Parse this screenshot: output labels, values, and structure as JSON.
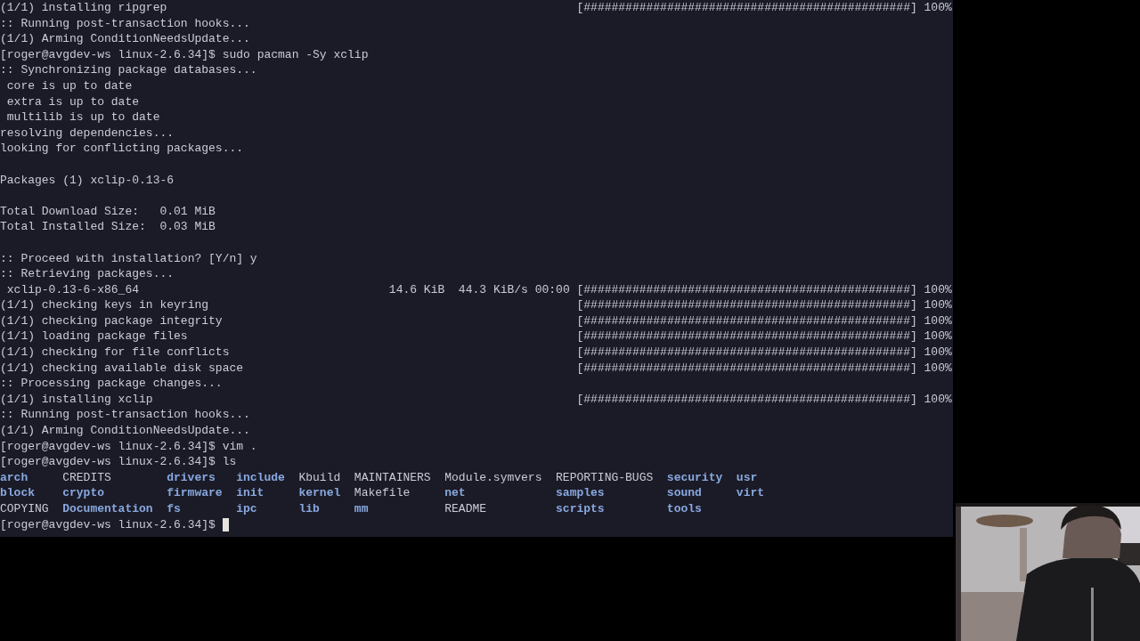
{
  "terminal": {
    "lines": [
      {
        "kind": "progress",
        "label": "(1/1) installing ripgrep",
        "bar": "[###############################################]",
        "percent": "100%"
      },
      {
        "kind": "plain",
        "text": ":: Running post-transaction hooks..."
      },
      {
        "kind": "plain",
        "text": "(1/1) Arming ConditionNeedsUpdate..."
      },
      {
        "kind": "prompt",
        "prompt": "[roger@avgdev-ws linux-2.6.34]$",
        "command": "sudo pacman -Sy xclip",
        "cursor": false
      },
      {
        "kind": "plain",
        "text": ":: Synchronizing package databases..."
      },
      {
        "kind": "plain",
        "text": " core is up to date"
      },
      {
        "kind": "plain",
        "text": " extra is up to date"
      },
      {
        "kind": "plain",
        "text": " multilib is up to date"
      },
      {
        "kind": "plain",
        "text": "resolving dependencies..."
      },
      {
        "kind": "plain",
        "text": "looking for conflicting packages..."
      },
      {
        "kind": "blank"
      },
      {
        "kind": "plain",
        "text": "Packages (1) xclip-0.13-6"
      },
      {
        "kind": "blank"
      },
      {
        "kind": "plain",
        "text": "Total Download Size:   0.01 MiB"
      },
      {
        "kind": "plain",
        "text": "Total Installed Size:  0.03 MiB"
      },
      {
        "kind": "blank"
      },
      {
        "kind": "plain",
        "text": ":: Proceed with installation? [Y/n] y"
      },
      {
        "kind": "plain",
        "text": ":: Retrieving packages..."
      },
      {
        "kind": "progress",
        "label": " xclip-0.13-6-x86_64",
        "info": "14.6 KiB  44.3 KiB/s 00:00",
        "bar": "[###############################################]",
        "percent": "100%"
      },
      {
        "kind": "progress",
        "label": "(1/1) checking keys in keyring",
        "bar": "[###############################################]",
        "percent": "100%"
      },
      {
        "kind": "progress",
        "label": "(1/1) checking package integrity",
        "bar": "[###############################################]",
        "percent": "100%"
      },
      {
        "kind": "progress",
        "label": "(1/1) loading package files",
        "bar": "[###############################################]",
        "percent": "100%"
      },
      {
        "kind": "progress",
        "label": "(1/1) checking for file conflicts",
        "bar": "[###############################################]",
        "percent": "100%"
      },
      {
        "kind": "progress",
        "label": "(1/1) checking available disk space",
        "bar": "[###############################################]",
        "percent": "100%"
      },
      {
        "kind": "plain",
        "text": ":: Processing package changes..."
      },
      {
        "kind": "progress",
        "label": "(1/1) installing xclip",
        "bar": "[###############################################]",
        "percent": "100%"
      },
      {
        "kind": "plain",
        "text": ":: Running post-transaction hooks..."
      },
      {
        "kind": "plain",
        "text": "(1/1) Arming ConditionNeedsUpdate..."
      },
      {
        "kind": "prompt",
        "prompt": "[roger@avgdev-ws linux-2.6.34]$",
        "command": "vim .",
        "cursor": false
      },
      {
        "kind": "prompt",
        "prompt": "[roger@avgdev-ws linux-2.6.34]$",
        "command": "ls",
        "cursor": false
      },
      {
        "kind": "listing",
        "entries": [
          {
            "name": "arch",
            "directory": true
          },
          {
            "name": "CREDITS",
            "directory": false
          },
          {
            "name": "drivers",
            "directory": true
          },
          {
            "name": "include",
            "directory": true
          },
          {
            "name": "Kbuild",
            "directory": false
          },
          {
            "name": "MAINTAINERS",
            "directory": false
          },
          {
            "name": "Module.symvers",
            "directory": false
          },
          {
            "name": "REPORTING-BUGS",
            "directory": false
          },
          {
            "name": "security",
            "directory": true
          },
          {
            "name": "usr",
            "directory": true
          }
        ]
      },
      {
        "kind": "listing",
        "entries": [
          {
            "name": "block",
            "directory": true
          },
          {
            "name": "crypto",
            "directory": true
          },
          {
            "name": "firmware",
            "directory": true
          },
          {
            "name": "init",
            "directory": true
          },
          {
            "name": "kernel",
            "directory": true
          },
          {
            "name": "Makefile",
            "directory": false
          },
          {
            "name": "net",
            "directory": true
          },
          {
            "name": "samples",
            "directory": true
          },
          {
            "name": "sound",
            "directory": true
          },
          {
            "name": "virt",
            "directory": true
          }
        ]
      },
      {
        "kind": "listing",
        "entries": [
          {
            "name": "COPYING",
            "directory": false
          },
          {
            "name": "Documentation",
            "directory": true
          },
          {
            "name": "fs",
            "directory": true
          },
          {
            "name": "ipc",
            "directory": true
          },
          {
            "name": "lib",
            "directory": true
          },
          {
            "name": "mm",
            "directory": true
          },
          {
            "name": "README",
            "directory": false
          },
          {
            "name": "scripts",
            "directory": true
          },
          {
            "name": "tools",
            "directory": true
          }
        ]
      },
      {
        "kind": "prompt",
        "prompt": "[roger@avgdev-ws linux-2.6.34]$",
        "cursor": true
      }
    ]
  }
}
